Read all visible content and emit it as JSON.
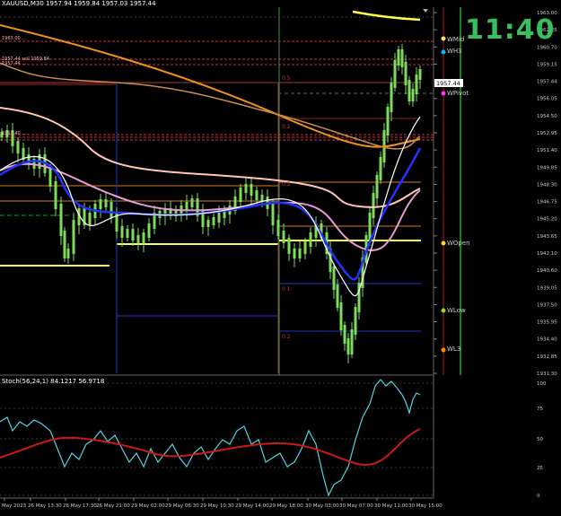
{
  "window": {
    "symbol_title": "XAUUSD,M30",
    "ohlc_text": "1957.94 1959.84 1957.03 1957.44"
  },
  "clock": "11:40",
  "indicator": {
    "title": "Stoch(56,24,1) 84.1217 56.9718",
    "axis_ticks": [
      "100",
      "75",
      "50",
      "25",
      "0"
    ]
  },
  "price_axis": {
    "ticks": [
      "1963.00",
      "1962.25",
      "1960.70",
      "1959.15",
      "1957.44",
      "1956.05",
      "1954.50",
      "1952.95",
      "1951.40",
      "1949.85",
      "1948.30",
      "1946.75",
      "1945.20",
      "1943.65",
      "1942.10",
      "1940.60",
      "1939.05",
      "1937.50",
      "1935.95",
      "1934.40",
      "1932.85",
      "1931.30"
    ],
    "current_price": "1957.44"
  },
  "time_axis": {
    "labels": [
      "May 2023",
      "26 May 13:30",
      "26 May 17:30",
      "26 May 21:00",
      "29 May 02:00",
      "29 May 06:30",
      "29 May 10:30",
      "29 May 14:00",
      "29 May 18:00",
      "30 May 03:00",
      "30 May 07:00",
      "30 May 11:00",
      "30 May 15:00"
    ]
  },
  "pivot_labels": {
    "wmid": "WMid",
    "wh3": "WH3",
    "wpivot": "WPivot",
    "wopen": "WOpen",
    "wlow": "WLow",
    "wl3": "WL3"
  },
  "left_levels": [
    "1963.00 ...",
    "1957.44 sell 1959.84",
    "1957.44 ...",
    "1953.40 ..."
  ],
  "zone_labels": [
    "0.5",
    "0.2",
    "0.1",
    "0.1",
    "0.2"
  ],
  "colors": {
    "background": "#000000",
    "candle": "#7ddc5a",
    "ma_blue": "#2233ff",
    "ma_white": "#ffffff",
    "ma_pink": "#e79bd6",
    "ma_salmon": "#ffc8b4",
    "ma_orange": "#f0901e",
    "level_yellow": "#ffff44",
    "stoch_main": "#52d6e6",
    "stoch_signal": "#d01818",
    "clock": "#36c060"
  }
}
